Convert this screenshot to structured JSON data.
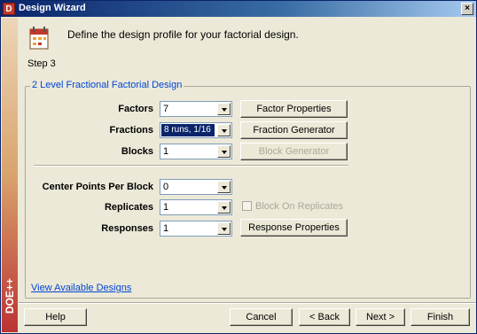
{
  "window": {
    "title": "Design Wizard",
    "app_icon": "D",
    "close_label": "×"
  },
  "sidebar": {
    "logo_text": "DOE++"
  },
  "header": {
    "instruction": "Define the design profile for your factorial design.",
    "step": "Step 3",
    "step_icon": "calendar-icon"
  },
  "group": {
    "title": "2 Level Fractional Factorial Design"
  },
  "form": {
    "factors": {
      "label": "Factors",
      "value": "7",
      "button": "Factor Properties"
    },
    "fractions": {
      "label": "Fractions",
      "value": "8 runs, 1/16",
      "button": "Fraction Generator"
    },
    "blocks": {
      "label": "Blocks",
      "value": "1",
      "button": "Block Generator"
    },
    "center_points": {
      "label": "Center Points Per Block",
      "value": "0"
    },
    "replicates": {
      "label": "Replicates",
      "value": "1",
      "checkbox_label": "Block On Replicates"
    },
    "responses": {
      "label": "Responses",
      "value": "1",
      "button": "Response Properties"
    }
  },
  "link": {
    "label": "View Available Designs"
  },
  "footer": {
    "help": "Help",
    "cancel": "Cancel",
    "back": "< Back",
    "next": "Next >",
    "finish": "Finish"
  }
}
